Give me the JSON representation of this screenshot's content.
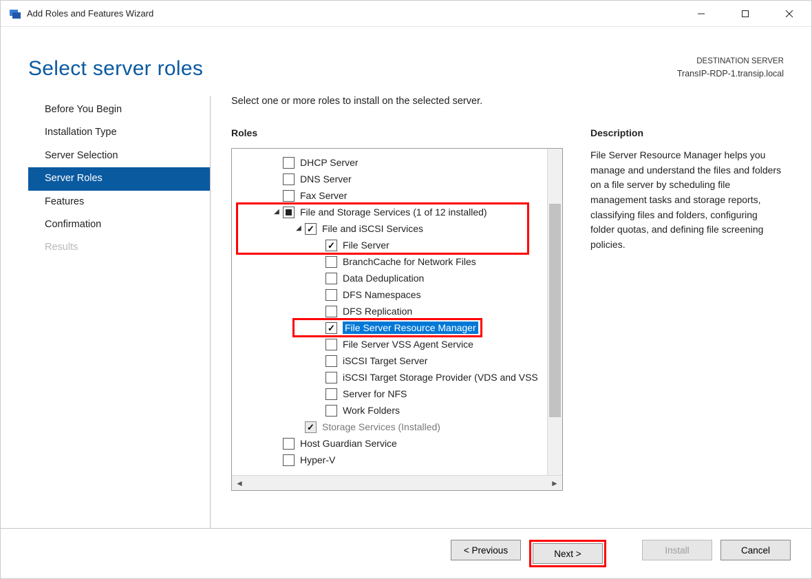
{
  "window": {
    "title": "Add Roles and Features Wizard"
  },
  "header": {
    "page_title": "Select server roles",
    "dest_label": "DESTINATION SERVER",
    "dest_server": "TransIP-RDP-1.transip.local"
  },
  "nav": {
    "items": [
      {
        "label": "Before You Begin",
        "state": "normal"
      },
      {
        "label": "Installation Type",
        "state": "normal"
      },
      {
        "label": "Server Selection",
        "state": "normal"
      },
      {
        "label": "Server Roles",
        "state": "active"
      },
      {
        "label": "Features",
        "state": "normal"
      },
      {
        "label": "Confirmation",
        "state": "normal"
      },
      {
        "label": "Results",
        "state": "disabled"
      }
    ]
  },
  "main": {
    "instruction": "Select one or more roles to install on the selected server.",
    "roles_heading": "Roles",
    "desc_heading": "Description",
    "description": "File Server Resource Manager helps you manage and understand the files and folders on a file server by scheduling file management tasks and storage reports, classifying files and folders, configuring folder quotas, and defining file screening policies."
  },
  "roles": [
    {
      "level": 1,
      "caret": "none",
      "check": "unchecked",
      "label": "DHCP Server"
    },
    {
      "level": 1,
      "caret": "none",
      "check": "unchecked",
      "label": "DNS Server"
    },
    {
      "level": 1,
      "caret": "none",
      "check": "unchecked",
      "label": "Fax Server"
    },
    {
      "level": 1,
      "caret": "open",
      "check": "indeterminate",
      "label": "File and Storage Services (1 of 12 installed)"
    },
    {
      "level": 2,
      "caret": "open",
      "check": "checked",
      "label": "File and iSCSI Services"
    },
    {
      "level": 3,
      "caret": "none",
      "check": "checked",
      "label": "File Server"
    },
    {
      "level": 3,
      "caret": "none",
      "check": "unchecked",
      "label": "BranchCache for Network Files"
    },
    {
      "level": 3,
      "caret": "none",
      "check": "unchecked",
      "label": "Data Deduplication"
    },
    {
      "level": 3,
      "caret": "none",
      "check": "unchecked",
      "label": "DFS Namespaces"
    },
    {
      "level": 3,
      "caret": "none",
      "check": "unchecked",
      "label": "DFS Replication"
    },
    {
      "level": 3,
      "caret": "none",
      "check": "checked",
      "label": "File Server Resource Manager",
      "selected": true
    },
    {
      "level": 3,
      "caret": "none",
      "check": "unchecked",
      "label": "File Server VSS Agent Service"
    },
    {
      "level": 3,
      "caret": "none",
      "check": "unchecked",
      "label": "iSCSI Target Server"
    },
    {
      "level": 3,
      "caret": "none",
      "check": "unchecked",
      "label": "iSCSI Target Storage Provider (VDS and VSS"
    },
    {
      "level": 3,
      "caret": "none",
      "check": "unchecked",
      "label": "Server for NFS"
    },
    {
      "level": 3,
      "caret": "none",
      "check": "unchecked",
      "label": "Work Folders"
    },
    {
      "level": 2,
      "caret": "none",
      "check": "checked-disabled",
      "label": "Storage Services (Installed)",
      "dim": true
    },
    {
      "level": 1,
      "caret": "none",
      "check": "unchecked",
      "label": "Host Guardian Service"
    },
    {
      "level": 1,
      "caret": "none",
      "check": "unchecked",
      "label": "Hyper-V"
    }
  ],
  "buttons": {
    "previous": "< Previous",
    "next": "Next >",
    "install": "Install",
    "cancel": "Cancel"
  }
}
